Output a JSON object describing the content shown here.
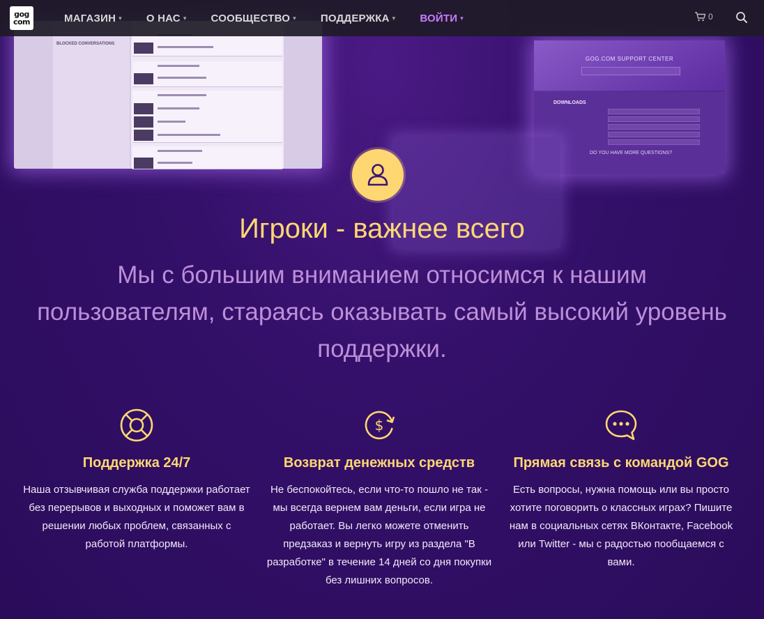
{
  "logo": {
    "line1": "gog",
    "line2": "com"
  },
  "nav": {
    "items": [
      {
        "label": "МАГАЗИН"
      },
      {
        "label": "О НАС"
      },
      {
        "label": "СООБЩЕСТВО"
      },
      {
        "label": "ПОДДЕРЖКА"
      },
      {
        "label": "ВОЙТИ"
      }
    ],
    "cart_count": "0"
  },
  "bg_screens": {
    "left": {
      "sidebar_item": "BLOCKED CONVERSATIONS"
    },
    "right": {
      "title": "GOG.COM SUPPORT CENTER",
      "section": "DOWNLOADS",
      "question": "DO YOU HAVE MORE QUESTIONS?"
    }
  },
  "hero": {
    "title": "Игроки - важнее всего",
    "subtitle": "Мы с большим вниманием относимся к нашим пользователям, стараясь оказывать самый высокий уровень поддержки."
  },
  "features": [
    {
      "icon": "lifebuoy-icon",
      "title": "Поддержка 24/7",
      "text": "Наша отзывчивая служба поддержки работает без перерывов и выходных и поможет вам в решении любых проблем, связанных с работой платформы."
    },
    {
      "icon": "money-back-icon",
      "title": "Возврат денежных средств",
      "text": "Не беспокойтесь, если что-то пошло не так - мы всегда вернем вам деньги, если игра не работает. Вы легко можете отменить предзаказ и вернуть игру из раздела \"В разработке\" в течение 14 дней со дня покупки без лишних вопросов."
    },
    {
      "icon": "chat-bubble-icon",
      "title": "Прямая связь с командой GOG",
      "text": "Есть вопросы, нужна помощь или вы просто хотите поговорить о классных играх? Пишите нам в социальных сетях ВКонтакте, Facebook или Twitter - мы с радостью пообщаемся с вами."
    }
  ],
  "colors": {
    "accent_gold": "#ffd772",
    "accent_purple": "#c77cff",
    "subtitle_lilac": "#bc8fd8",
    "topbar": "#1e1a26"
  }
}
